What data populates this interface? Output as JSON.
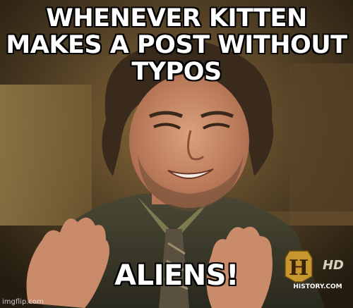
{
  "meme": {
    "top_text": "WHENEVER KITTEN MAKES A POST WITHOUT TYPOS",
    "bottom_text": "ALIENS!"
  },
  "channel_logo": {
    "letter": "H",
    "badge": "HD",
    "site": "HISTORY.COM"
  },
  "watermark": "imgflip.com",
  "colors": {
    "caption_fill": "#ffffff",
    "caption_outline": "#000000",
    "logo_gold": "#c8962e",
    "suit": "#3b3a2c",
    "skin": "#c98b6a",
    "hair": "#3a2a1c"
  }
}
